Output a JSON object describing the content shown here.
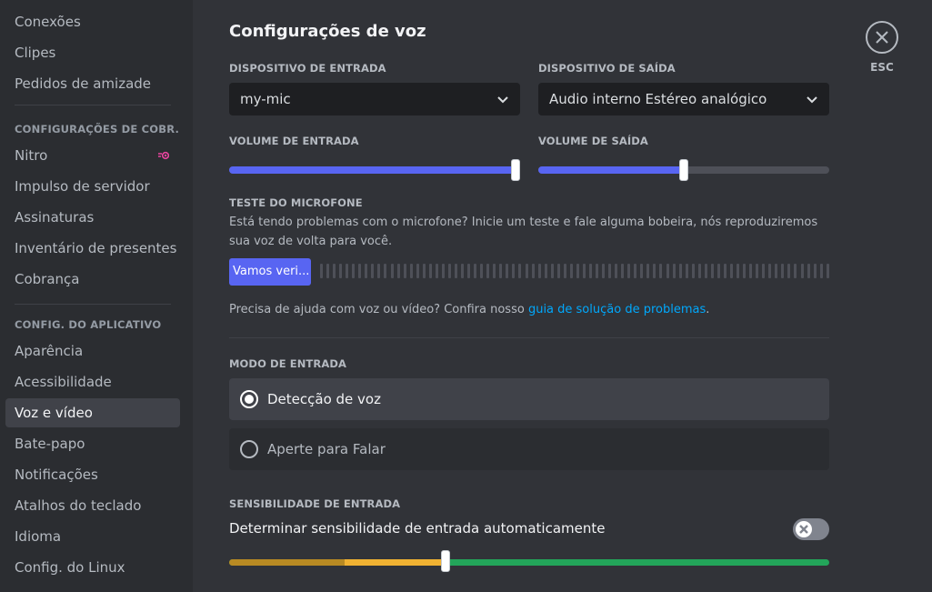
{
  "sidebar": {
    "items_top": [
      {
        "label": "Conexões"
      },
      {
        "label": "Clipes"
      },
      {
        "label": "Pedidos de amizade"
      }
    ],
    "billing_header": "CONFIGURAÇÕES DE COBR...",
    "billing_items": [
      {
        "label": "Nitro",
        "icon": "nitro-icon"
      },
      {
        "label": "Impulso de servidor"
      },
      {
        "label": "Assinaturas"
      },
      {
        "label": "Inventário de presentes"
      },
      {
        "label": "Cobrança"
      }
    ],
    "app_header": "CONFIG. DO APLICATIVO",
    "app_items": [
      {
        "label": "Aparência"
      },
      {
        "label": "Acessibilidade"
      },
      {
        "label": "Voz e vídeo",
        "selected": true
      },
      {
        "label": "Bate-papo"
      },
      {
        "label": "Notificações"
      },
      {
        "label": "Atalhos do teclado"
      },
      {
        "label": "Idioma"
      },
      {
        "label": "Config. do Linux"
      }
    ]
  },
  "main": {
    "title": "Configurações de voz",
    "input_device": {
      "label": "DISPOSITIVO DE ENTRADA",
      "value": "my-mic"
    },
    "output_device": {
      "label": "DISPOSITIVO DE SAÍDA",
      "value": "Audio interno Estéreo analógico"
    },
    "input_volume": {
      "label": "VOLUME DE ENTRADA",
      "level": 1.0
    },
    "output_volume": {
      "label": "VOLUME DE SAÍDA",
      "level": 0.5
    },
    "mic_test": {
      "label": "TESTE DO MICROFONE",
      "description": "Está tendo problemas com o microfone? Inicie um teste e fale alguma bobeira, nós reproduziremos sua voz de volta para você.",
      "button": "Vamos veri..."
    },
    "help": {
      "prefix": "Precisa de ajuda com voz ou vídeo? Confira nosso ",
      "link": "guia de solução de problemas",
      "suffix": "."
    },
    "input_mode": {
      "label": "MODO DE ENTRADA",
      "options": [
        {
          "label": "Detecção de voz",
          "selected": true
        },
        {
          "label": "Aperte para Falar",
          "selected": false
        }
      ]
    },
    "sensitivity": {
      "label": "SENSIBILIDADE DE ENTRADA",
      "auto_label": "Determinar sensibilidade de entrada automaticamente",
      "auto_enabled": false,
      "threshold": 0.36
    }
  },
  "close": {
    "label": "ESC",
    "icon": "close-icon"
  },
  "colors": {
    "accent": "#5865f2",
    "link": "#00a8fc",
    "sens_low": "#b88a23",
    "sens_mid": "#f0b232",
    "sens_high": "#23a55a"
  }
}
